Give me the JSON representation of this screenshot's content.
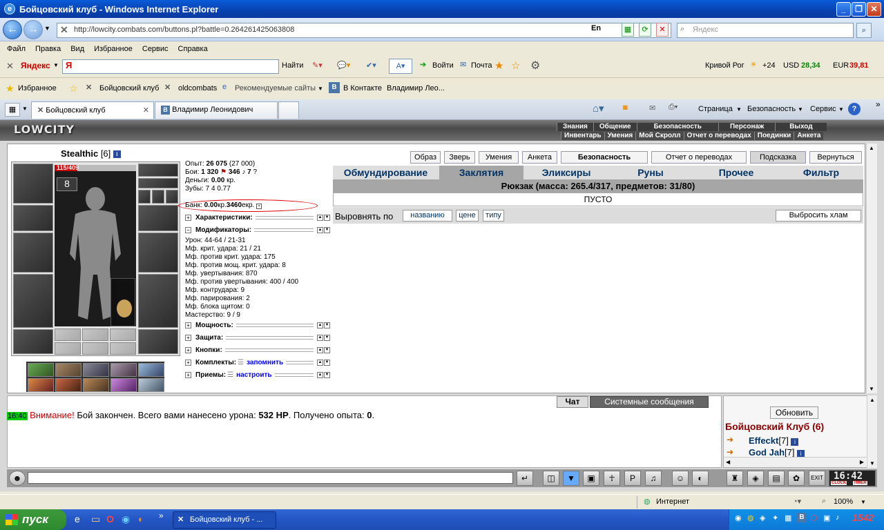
{
  "window": {
    "title": "Бойцовский клуб - Windows Internet Explorer"
  },
  "address": {
    "url": "http://lowcity.combats.com/buttons.pl?battle=0.264261425063808",
    "lang": "En",
    "search_placeholder": "Яндекс"
  },
  "menu": [
    "Файл",
    "Правка",
    "Вид",
    "Избранное",
    "Сервис",
    "Справка"
  ],
  "yandex": {
    "label": "Яндекс",
    "input": "Я",
    "find": "Найти",
    "login": "Войти",
    "mail": "Почта",
    "city": "Кривой Рог",
    "temp": "+24",
    "usd_label": "USD",
    "usd": "28,34",
    "eur_label": "EUR",
    "eur": "39,81"
  },
  "favorites": {
    "label": "Избранное",
    "items": [
      "Бойцовский клуб",
      "oldcombats",
      "Рекомендуемые сайты",
      "В Контакте",
      "Владимир Лео..."
    ]
  },
  "tabs": [
    {
      "label": "Бойцовский клуб"
    },
    {
      "label": "Владимир Леонидович"
    }
  ],
  "ietools": {
    "page": "Страница",
    "safety": "Безопасность",
    "service": "Сервис"
  },
  "game": {
    "logo": "LOWCITY",
    "topmenu1": [
      "Знания",
      "Общение",
      "Безопасность",
      "Персонаж",
      "Выход"
    ],
    "topmenu2": [
      "Инвентарь",
      "Умения",
      "Мой Скролл",
      "Отчет о переводах",
      "Поединки",
      "Анкета"
    ],
    "character": {
      "name": "Stealthic",
      "level": "[6]",
      "hp_text": "115/409",
      "hp_fraction": 0.28
    },
    "stats": {
      "exp_label": "Опыт:",
      "exp": "26 075",
      "exp_next": "(27 000)",
      "fights_label": "Бои:",
      "wins": "1 320",
      "losses": "346",
      "draws": "7",
      "money_label": "Деньги:",
      "money": "0.00",
      "money_unit": "кр.",
      "teeth_label": "Зубы:",
      "teeth": "7  4  0.77",
      "bank_label": "Банк:",
      "bank_kr": "0.00",
      "bank_kr_unit": "кр.",
      "bank_ekr": "3460",
      "bank_ekr_unit": "екр."
    },
    "sections": {
      "characteristics": "Характеристики:",
      "modifiers": "Модификаторы:",
      "power": "Мощность:",
      "protection": "Защита:",
      "buttons": "Кнопки:",
      "sets": "Комплекты:",
      "sets_link": "запомнить",
      "techniques": "Приемы:",
      "techniques_link": "настроить"
    },
    "modifiers": [
      "Урон: 44-64 / 21-31",
      "Мф. крит. удара: 21 / 21",
      "Мф. против крит. удара: 175",
      "Мф. против мощ. крит. удара: 8",
      "Мф. увертывания: 870",
      "Мф. против увертывания: 400 / 400",
      "Мф. контрудара: 9",
      "Мф. парирования: 2",
      "Мф. блока щитом: 0",
      "Мастерство: 9 / 9"
    ],
    "buttons": [
      "Образ",
      "Зверь",
      "Умения",
      "Анкета",
      "Безопасность",
      "Отчет о переводах",
      "Подсказка",
      "Вернуться"
    ],
    "inv_tabs": [
      "Обмундирование",
      "Заклятия",
      "Эликсиры",
      "Руны",
      "Прочее",
      "Фильтр"
    ],
    "backpack": "Рюкзак (масса: 265.4/317, предметов: 31/80)",
    "empty": "ПУСТО",
    "sort_label": "Выровнять по",
    "sort_buttons": [
      "названию",
      "цене",
      "типу"
    ],
    "junk_button": "Выбросить хлам"
  },
  "chat": {
    "tabs": [
      "Чат",
      "Системные сообщения"
    ],
    "time": "16:40",
    "warn": "Внимание!",
    "msg1": " Бой закончен. Всего вами нанесено урона: ",
    "dmg": "532 HP",
    "msg2": ". Получено опыта: ",
    "exp": "0",
    "msg3": ".",
    "refresh": "Обновить",
    "room": "Бойцовский Клуб (6)",
    "players": [
      {
        "name": "Effeckt",
        "level": "[7]"
      },
      {
        "name": "God Jah",
        "level": "[7]"
      }
    ],
    "clock": "16:42",
    "clock_label": "CLOCK",
    "timer_label": "TIMER"
  },
  "status": {
    "zone": "Интернет",
    "zoom": "100%"
  },
  "taskbar": {
    "start": "пуск",
    "window": "Бойцовский клуб - ...",
    "tray_text": "1542"
  },
  "colors": {
    "accent": "#036699",
    "hp": "#cc0000",
    "warning": "#cc0000"
  }
}
